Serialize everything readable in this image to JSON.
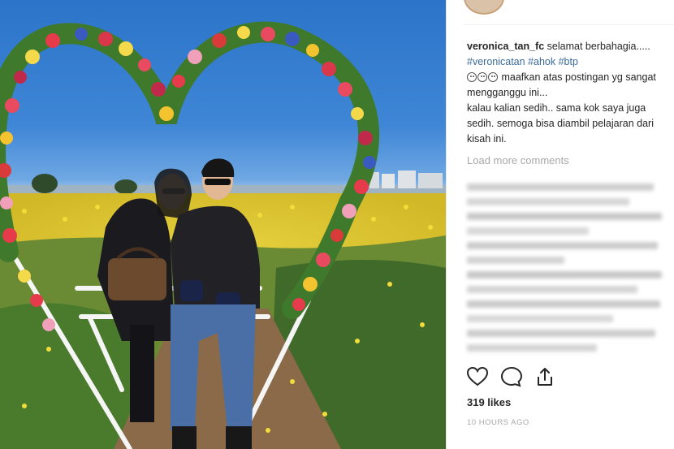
{
  "post": {
    "username": "veronica_tan_fc",
    "caption_intro": " selamat berbahagia.....",
    "hashtags": [
      "#veronicatan",
      "#ahok",
      "#btp"
    ],
    "caption_lines": [
      "maafkan atas postingan yg sangat",
      "mengganggu ini...",
      "kalau kalian sedih.. sama kok saya juga",
      "sedih. semoga bisa diambil pelajaran dari",
      "kisah ini."
    ],
    "emoji_count": 3,
    "load_more": "Load more comments",
    "likes": "319 likes",
    "timestamp": "10 HOURS AGO"
  },
  "icons": {
    "like": "heart-icon",
    "comment": "comment-bubble-icon",
    "share": "share-upload-icon"
  },
  "colors": {
    "hashtag": "#3b6b9b",
    "text": "#262626",
    "muted": "#a8a8a8"
  }
}
